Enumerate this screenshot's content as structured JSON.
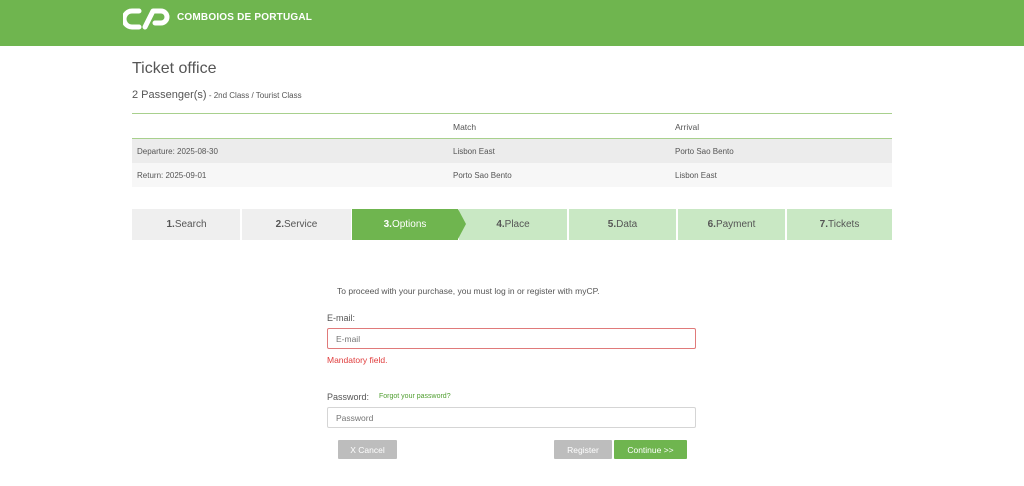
{
  "header": {
    "brand": "COMBOIOS DE PORTUGAL",
    "logo_icon": "cp-logo-icon",
    "bg": "#6fb54f"
  },
  "page": {
    "title": "Ticket office",
    "passengers": "2 Passenger(s)",
    "class_info": " - 2nd Class / Tourist Class"
  },
  "journey": {
    "headers": [
      "",
      "Match",
      "Arrival"
    ],
    "rows": [
      [
        "Departure: 2025-08-30",
        "Lisbon East",
        "Porto Sao Bento"
      ],
      [
        "Return: 2025-09-01",
        "Porto Sao Bento",
        "Lisbon East"
      ]
    ]
  },
  "steps": [
    {
      "num": "1.",
      "label": "Search"
    },
    {
      "num": "2.",
      "label": "Service"
    },
    {
      "num": "3.",
      "label": "Options"
    },
    {
      "num": "4.",
      "label": "Place"
    },
    {
      "num": "5.",
      "label": "Data"
    },
    {
      "num": "6.",
      "label": "Payment"
    },
    {
      "num": "7.",
      "label": "Tickets"
    }
  ],
  "login": {
    "notice": "To proceed with your purchase, you must log in or register with myCP.",
    "email_label": "E-mail:",
    "email_placeholder": "E-mail",
    "email_error": "Mandatory field.",
    "password_label": "Password:",
    "forgot": "Forgot your password?",
    "password_placeholder": "Password",
    "cancel": "X Cancel",
    "register": "Register",
    "continue": "Continue >>"
  }
}
